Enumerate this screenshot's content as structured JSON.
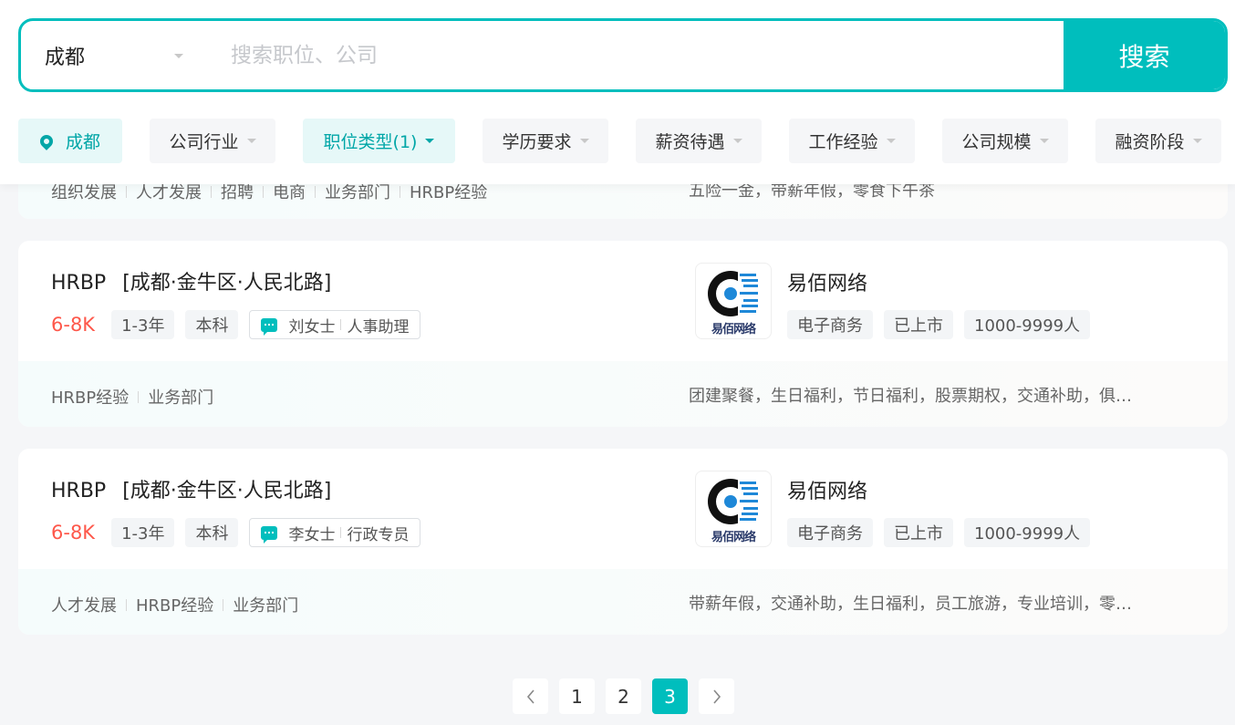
{
  "search": {
    "city": "成都",
    "placeholder": "搜索职位、公司",
    "button_label": "搜索"
  },
  "filters": {
    "city": "成都",
    "items": [
      "公司行业",
      "职位类型(1)",
      "学历要求",
      "薪资待遇",
      "工作经验",
      "公司规模",
      "融资阶段"
    ],
    "active": "职位类型(1)"
  },
  "partial_card": {
    "tags": [
      "组织发展",
      "人才发展",
      "招聘",
      "电商",
      "业务部门",
      "HRBP经验"
    ],
    "welfare": "五险一金，带薪年假，零食下午茶"
  },
  "jobs": [
    {
      "title": "HRBP",
      "location": "[成都·金牛区·人民北路]",
      "salary": "6-8K",
      "experience": "1-3年",
      "education": "本科",
      "recruiter_name": "刘女士",
      "recruiter_title": "人事助理",
      "company": "易佰网络",
      "logo_text": "易佰网络",
      "industry": "电子商务",
      "stage": "已上市",
      "size": "1000-9999人",
      "tags": [
        "HRBP经验",
        "业务部门"
      ],
      "welfare": "团建聚餐，生日福利，节日福利，股票期权，交通补助，俱…"
    },
    {
      "title": "HRBP",
      "location": "[成都·金牛区·人民北路]",
      "salary": "6-8K",
      "experience": "1-3年",
      "education": "本科",
      "recruiter_name": "李女士",
      "recruiter_title": "行政专员",
      "company": "易佰网络",
      "logo_text": "易佰网络",
      "industry": "电子商务",
      "stage": "已上市",
      "size": "1000-9999人",
      "tags": [
        "人才发展",
        "HRBP经验",
        "业务部门"
      ],
      "welfare": "带薪年假，交通补助，生日福利，员工旅游，专业培训，零…"
    }
  ],
  "pagination": {
    "prev_icon": "chevron-left-icon",
    "next_icon": "chevron-right-icon",
    "pages": [
      "1",
      "2",
      "3"
    ],
    "current": "3"
  },
  "colors": {
    "accent": "#00bebd",
    "salary": "#fe574a",
    "active_filter_bg": "#e6f8f8"
  }
}
